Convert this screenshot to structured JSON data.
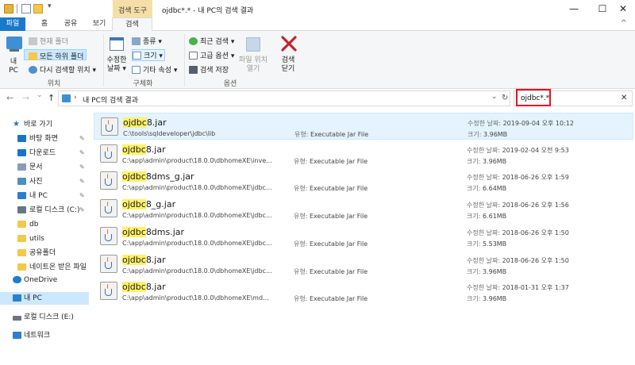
{
  "window": {
    "contextual_tab": "검색 도구",
    "title": "ojdbc*.* - 내 PC의 검색 결과",
    "controls": {
      "minimize": "—",
      "maximize": "☐",
      "close": "✕"
    }
  },
  "ribbon_tabs": {
    "file": "파일",
    "home": "홈",
    "share": "공유",
    "view": "보기",
    "search": "검색",
    "help_arrow": "^"
  },
  "ribbon": {
    "location": {
      "big_button": "내\nPC",
      "current_folder": "현재 폴더",
      "all_subfolders": "모든 하위 폴더",
      "search_again": "다시 검색할 위치 ▾",
      "label": "위치"
    },
    "refine": {
      "date_modified": "수정한\n날짜 ▾",
      "kind": "종류 ▾",
      "size": "크기 ▾",
      "other_properties": "기타 속성 ▾",
      "label": "구체화"
    },
    "options": {
      "recent_searches": "최근 검색 ▾",
      "advanced": "고급 옵션 ▾",
      "save_search": "검색 저장",
      "open_location": "파일 위치\n열기",
      "label": "옵션"
    },
    "close_search": "검색\n닫기"
  },
  "nav": {
    "back": "←",
    "forward": "→",
    "recent": "⌄",
    "up": "↑",
    "path_sep": "›",
    "address": "내 PC의 검색 결과",
    "dropdown": "⌄",
    "refresh": "↻",
    "search_value": "ojdbc*.*",
    "search_clear": "✕"
  },
  "sidebar": {
    "quick_access": "바로 가기",
    "items": [
      {
        "label": "바탕 화면",
        "pinned": true,
        "color": "#1a73c8"
      },
      {
        "label": "다운로드",
        "pinned": true,
        "color": "#1a73c8"
      },
      {
        "label": "문서",
        "pinned": true,
        "color": "#8a9bb4"
      },
      {
        "label": "사진",
        "pinned": true,
        "color": "#4a90c2"
      },
      {
        "label": "내 PC",
        "pinned": true,
        "color": "#2c7fd0"
      },
      {
        "label": "로컬 디스크 (C:)",
        "pinned": true,
        "color": "#6a7580"
      },
      {
        "label": "db",
        "pinned": false,
        "color": "#f3c84b"
      },
      {
        "label": "utils",
        "pinned": false,
        "color": "#f3c84b"
      },
      {
        "label": "공유폴더",
        "pinned": false,
        "color": "#f3c84b"
      },
      {
        "label": "네이트온 받은 파일",
        "pinned": false,
        "color": "#f3c84b"
      }
    ],
    "onedrive": "OneDrive",
    "this_pc": "내 PC",
    "drive_e": "로컬 디스크 (E:)",
    "network": "네트워크",
    "pin_glyph": "📌"
  },
  "results": {
    "labels": {
      "type": "유형:",
      "modified": "수정한 날짜:",
      "size": "크기:"
    },
    "files": [
      {
        "match": "ojdbc",
        "rest": "8.jar",
        "path": "C:\\tools\\sqldeveloper\\jdbc\\lib",
        "type": "Executable Jar File",
        "date": "2019-09-04 오후 10:12",
        "size": "3.96MB"
      },
      {
        "match": "ojdbc",
        "rest": "8.jar",
        "path": "C:\\app\\admin\\product\\18.0.0\\dbhomeXE\\inve...",
        "type": "Executable Jar File",
        "date": "2019-02-04 오전 9:53",
        "size": "3.96MB"
      },
      {
        "match": "ojdbc",
        "rest": "8dms_g.jar",
        "path": "C:\\app\\admin\\product\\18.0.0\\dbhomeXE\\jdbc...",
        "type": "Executable Jar File",
        "date": "2018-06-26 오후 1:59",
        "size": "6.64MB"
      },
      {
        "match": "ojdbc",
        "rest": "8_g.jar",
        "path": "C:\\app\\admin\\product\\18.0.0\\dbhomeXE\\jdbc...",
        "type": "Executable Jar File",
        "date": "2018-06-26 오후 1:56",
        "size": "6.61MB"
      },
      {
        "match": "ojdbc",
        "rest": "8dms.jar",
        "path": "C:\\app\\admin\\product\\18.0.0\\dbhomeXE\\jdbc...",
        "type": "Executable Jar File",
        "date": "2018-06-26 오후 1:50",
        "size": "5.53MB"
      },
      {
        "match": "ojdbc",
        "rest": "8.jar",
        "path": "C:\\app\\admin\\product\\18.0.0\\dbhomeXE\\jdbc...",
        "type": "Executable Jar File",
        "date": "2018-06-26 오후 1:50",
        "size": "3.96MB"
      },
      {
        "match": "ojdbc",
        "rest": "8.jar",
        "path": "C:\\app\\admin\\product\\18.0.0\\dbhomeXE\\md...",
        "type": "Executable Jar File",
        "date": "2018-01-31 오후 1:37",
        "size": "3.96MB"
      }
    ]
  },
  "colors": {
    "accent": "#1979ca",
    "context_tab": "#f6dfa6",
    "selection": "#cce8ff",
    "highlight": "#fff169",
    "search_box_outline": "#e81123",
    "close_x": "#c4252c"
  }
}
